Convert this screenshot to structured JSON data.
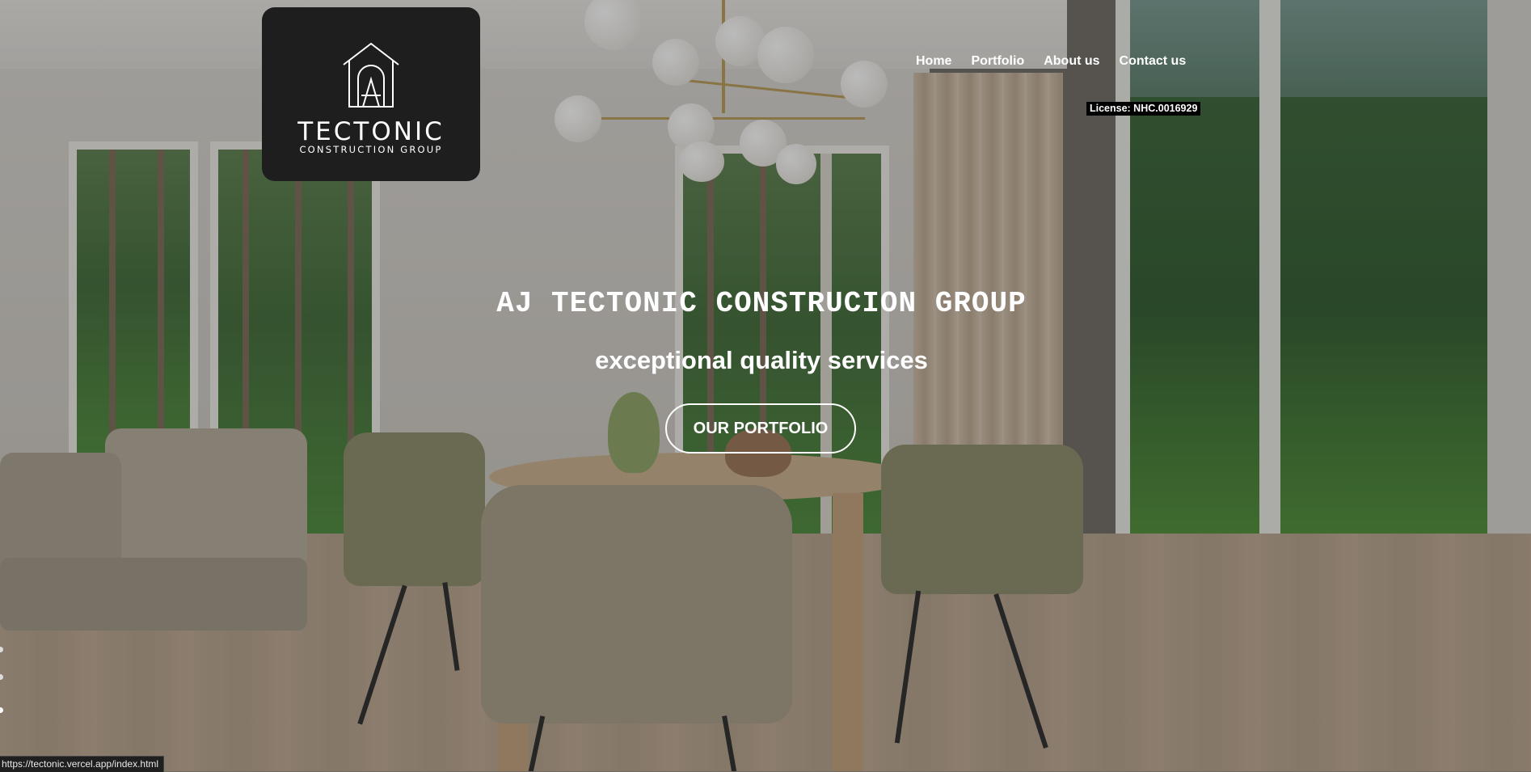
{
  "logo": {
    "name": "TECTONIC",
    "subtitle": "CONSTRUCTION GROUP",
    "icon": "house-logo-icon"
  },
  "nav": {
    "items": [
      {
        "label": "Home"
      },
      {
        "label": "Portfolio"
      },
      {
        "label": "About us"
      },
      {
        "label": "Contact us"
      }
    ]
  },
  "license": "License: NHC.0016929",
  "hero": {
    "title": "AJ TECTONIC CONSTRUCION GROUP",
    "subtitle": "exceptional quality services",
    "button_label": "OUR PORTFOLIO"
  },
  "status_bar": {
    "url": "https://tectonic.vercel.app/index.html"
  },
  "colors": {
    "logo_background": "#1e1e1e",
    "text": "#ffffff",
    "license_background": "#000000"
  }
}
